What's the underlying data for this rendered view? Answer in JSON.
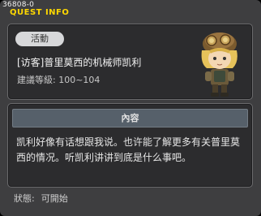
{
  "window": {
    "quest_id": "36808-0",
    "title": "QUEST INFO"
  },
  "quest": {
    "badge": "活動",
    "name": "[访客]普里莫西的机械师凯利",
    "level": "建議等級: 100~104"
  },
  "content": {
    "header": "內容",
    "description": "凯利好像有话想跟我说。也许能了解更多有关普里莫西的情况。听凯利讲讲到底是什么事吧。"
  },
  "status": {
    "label": "狀態:",
    "value": "可開始"
  }
}
